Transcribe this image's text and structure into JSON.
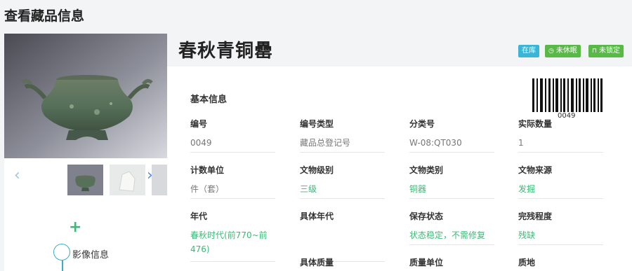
{
  "page_title": "查看藏品信息",
  "item": {
    "title": "春秋青铜罍",
    "badges": [
      {
        "label": "在库",
        "icon": "",
        "color": "#3ab5d6"
      },
      {
        "label": "未休眠",
        "icon": "clock-icon",
        "color": "#58b947"
      },
      {
        "label": "未锁定",
        "icon": "lock-icon",
        "color": "#58b947"
      }
    ],
    "barcode_number": "0049"
  },
  "gallery": {
    "thumbnails": [
      "bronze-vessel",
      "white-jade",
      "partial"
    ]
  },
  "side": {
    "timeline_label": "影像信息"
  },
  "basic_info": {
    "section_title": "基本信息",
    "fields": [
      {
        "label": "编号",
        "value": "0049"
      },
      {
        "label": "编号类型",
        "value": "藏品总登记号"
      },
      {
        "label": "分类号",
        "value": "W-08:QT030"
      },
      {
        "label": "实际数量",
        "value": "1"
      },
      {
        "label": "计数单位",
        "value": "件（套）"
      },
      {
        "label": "文物级别",
        "value": "三级"
      },
      {
        "label": "文物类别",
        "value": "铜器"
      },
      {
        "label": "文物来源",
        "value": "发掘"
      },
      {
        "label": "年代",
        "value": "春秋时代(前770~前476)"
      },
      {
        "label": "具体年代",
        "value": ""
      },
      {
        "label": "保存状态",
        "value": "状态稳定，不需修复"
      },
      {
        "label": "完残程度",
        "value": "残缺"
      },
      {
        "label": "具体质量",
        "value": ""
      },
      {
        "label": "质量单位",
        "value": ""
      },
      {
        "label": "质地",
        "value": ""
      }
    ]
  }
}
